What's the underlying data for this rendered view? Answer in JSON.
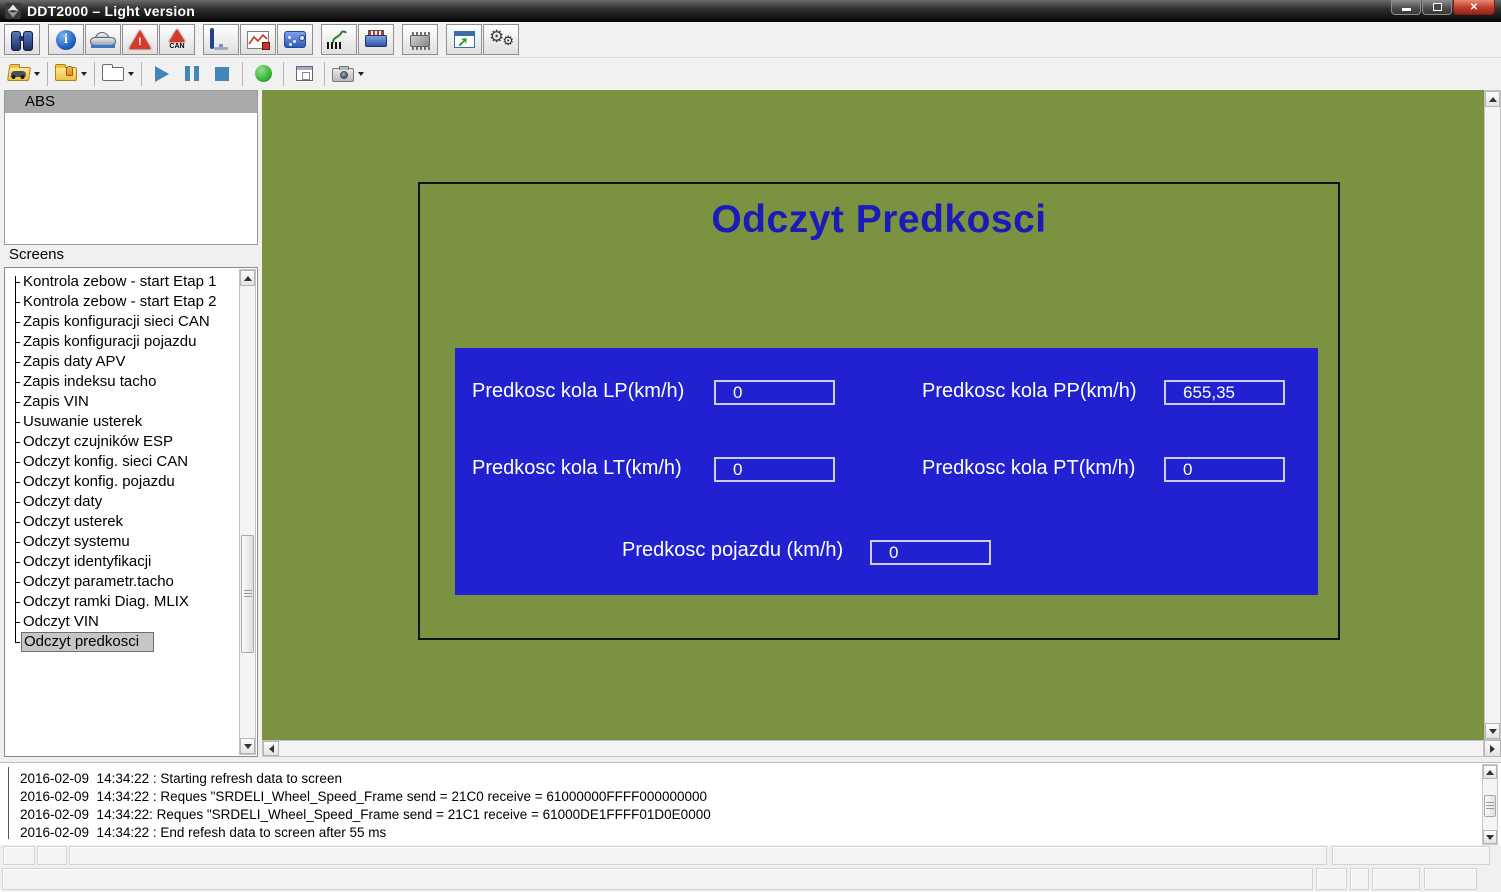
{
  "window": {
    "title": "DDT2000 – Light version",
    "controls": [
      "minimize",
      "restore",
      "close"
    ]
  },
  "toolbar_main": {
    "buttons": [
      "search",
      "info",
      "vehicle",
      "alert",
      "alert-can",
      "monitor",
      "graph-save",
      "control-panel",
      "sensor-cable",
      "connector",
      "chip",
      "export-window",
      "settings-gears"
    ],
    "can_badge": "CAN",
    "alert_glyph": "!"
  },
  "toolbar_secondary": {
    "buttons": [
      "open-vehicle-folder",
      "open-key-folder",
      "open-folder",
      "play",
      "pause",
      "stop",
      "record",
      "form-window",
      "snapshot-camera"
    ]
  },
  "sidebar": {
    "system_label": "ABS",
    "screens_label": "Screens",
    "screens": [
      "Kontrola zebow - start Etap 1",
      "Kontrola zebow - start Etap 2",
      "Zapis konfiguracji sieci CAN",
      "Zapis konfiguracji pojazdu",
      "Zapis daty APV",
      "Zapis indeksu tacho",
      "Zapis VIN",
      "Usuwanie usterek",
      "Odczyt czujników ESP",
      "Odczyt konfig. sieci CAN",
      "Odczyt konfig. pojazdu",
      "Odczyt daty",
      "Odczyt usterek",
      "Odczyt systemu",
      "Odczyt identyfikacji",
      "Odczyt parametr.tacho",
      "Odczyt ramki Diag. MLIX",
      "Odczyt VIN",
      "Odczyt predkosci"
    ],
    "selected_screen": "Odczyt predkosci"
  },
  "panel": {
    "title": "Odczyt Predkosci",
    "fields": [
      {
        "label": "Predkosc kola LP(km/h)",
        "value": "0"
      },
      {
        "label": "Predkosc kola PP(km/h)",
        "value": "655,35"
      },
      {
        "label": "Predkosc kola LT(km/h)",
        "value": "0"
      },
      {
        "label": "Predkosc kola PT(km/h)",
        "value": "0"
      },
      {
        "label": "Predkosc pojazdu (km/h)",
        "value": "0"
      }
    ]
  },
  "log": {
    "lines": [
      "2016-02-09  14:34:22 : Starting refresh data to screen",
      "2016-02-09  14:34:22 : Reques \"SRDELI_Wheel_Speed_Frame send = 21C0 receive = 61000000FFFF000000000",
      "2016-02-09  14:34:22: Reques \"SRDELI_Wheel_Speed_Frame send = 21C1 receive = 61000DE1FFFF01D0E0000",
      "2016-02-09  14:34:22 : End refesh data to screen after 55 ms"
    ]
  },
  "colors": {
    "workspace": "#7B9340",
    "panel": "#2121D1",
    "panel-title": "#1B1BB8",
    "warning": "#D43A2A",
    "media": "#4187BA",
    "record": "#35B535"
  }
}
